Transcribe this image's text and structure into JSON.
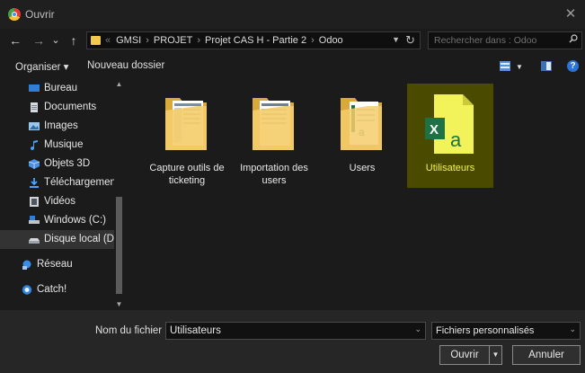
{
  "window": {
    "title": "Ouvrir"
  },
  "nav": {
    "back": "←",
    "forward": "→",
    "recent": "⌄",
    "up": "↑"
  },
  "address": {
    "prefix": "«",
    "crumbs": [
      "GMSI",
      "PROJET",
      "Projet CAS H - Partie 2",
      "Odoo"
    ],
    "separator": "›"
  },
  "search": {
    "placeholder": "Rechercher dans : Odoo"
  },
  "toolbar": {
    "organize": "Organiser ▾",
    "new_folder": "Nouveau dossier",
    "help": "?"
  },
  "sidebar": {
    "items": [
      {
        "label": "Bureau",
        "icon": "desktop-icon"
      },
      {
        "label": "Documents",
        "icon": "documents-icon"
      },
      {
        "label": "Images",
        "icon": "images-icon"
      },
      {
        "label": "Musique",
        "icon": "music-icon"
      },
      {
        "label": "Objets 3D",
        "icon": "objects-3d-icon"
      },
      {
        "label": "Téléchargements",
        "icon": "downloads-icon"
      },
      {
        "label": "Vidéos",
        "icon": "videos-icon"
      },
      {
        "label": "Windows (C:)",
        "icon": "drive-icon"
      },
      {
        "label": "Disque local (D:)",
        "icon": "drive-icon"
      },
      {
        "label": "Réseau",
        "icon": "network-icon"
      },
      {
        "label": "Catch!",
        "icon": "catch-icon"
      }
    ]
  },
  "files": [
    {
      "name": "Capture outils de ticketing",
      "type": "folder"
    },
    {
      "name": "Importation des users",
      "type": "folder"
    },
    {
      "name": "Users",
      "type": "folder"
    },
    {
      "name": "Utilisateurs",
      "type": "excel-file"
    }
  ],
  "bottom": {
    "filename_label": "Nom du fichier :",
    "filename_value": "Utilisateurs",
    "filter_value": "Fichiers personnalisés",
    "open_label": "Ouvrir",
    "cancel_label": "Annuler"
  },
  "colors": {
    "background": "#1b1b1b",
    "selection": "#4b4b00",
    "selection_text": "#f1f15a",
    "folder": "#f2c94c",
    "excel_green": "#1e7145"
  }
}
